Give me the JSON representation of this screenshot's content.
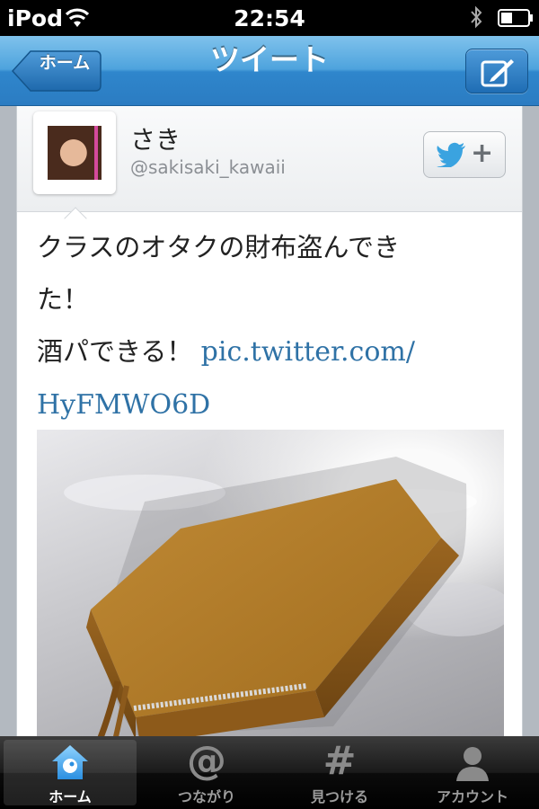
{
  "status_bar": {
    "carrier": "iPod",
    "time": "22:54"
  },
  "navbar": {
    "back_label": "ホーム",
    "title": "ツイート",
    "compose_icon": "compose-icon"
  },
  "tweet": {
    "user": {
      "name": "さき",
      "handle": "@sakisaki_kawaii"
    },
    "follow_plus": "+",
    "text_line1": "クラスのオタクの財布盗んでき",
    "text_line2": "た！",
    "text_line3": "酒パできる！ ",
    "link_part1": "pic.twitter.com/",
    "link_part2": "HyFMWO6D"
  },
  "tabs": [
    {
      "label": "ホーム",
      "icon": "home-bird-icon",
      "active": true
    },
    {
      "label": "つながり",
      "icon": "at-icon",
      "glyph": "@"
    },
    {
      "label": "見つける",
      "icon": "hash-icon",
      "glyph": "#"
    },
    {
      "label": "アカウント",
      "icon": "person-icon"
    }
  ],
  "colors": {
    "nav_blue": "#2f86cc",
    "link_blue": "#2f72a6",
    "wallet_tan": "#b07a2a"
  }
}
